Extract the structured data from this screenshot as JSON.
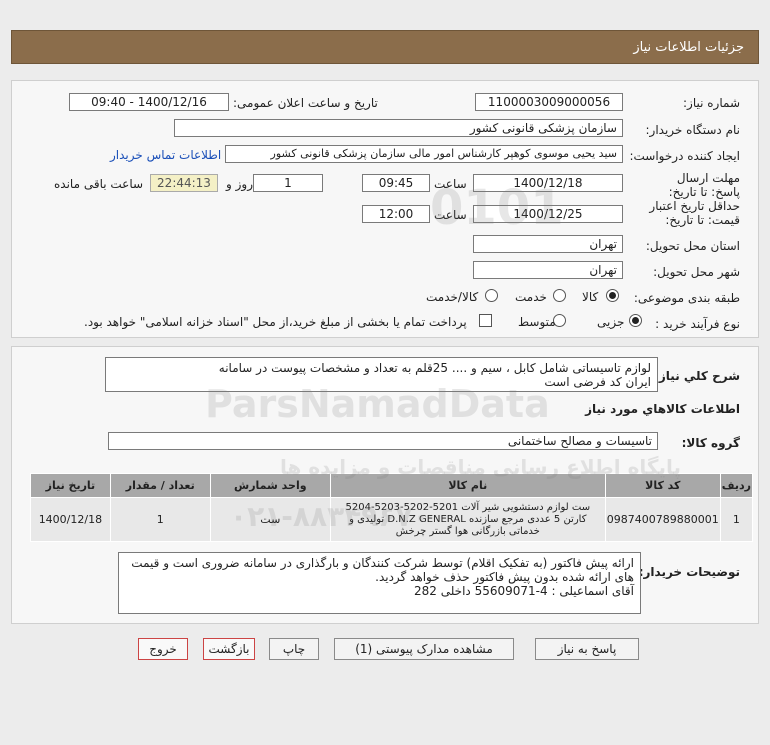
{
  "header": {
    "title": "جزئیات اطلاعات نیاز"
  },
  "info": {
    "need_number_label": "شماره نیاز:",
    "need_number": "1100003009000056",
    "announce_label": "تاریخ و ساعت اعلان عمومی:",
    "announce_value": "1400/12/16 - 09:40",
    "buyer_org_label": "نام دستگاه خریدار:",
    "buyer_org": "سازمان پزشکی قانونی کشور",
    "creator_label": "ایجاد کننده درخواست:",
    "creator": "سید یحیی موسوی کوهپر کارشناس امور مالی سازمان پزشکی قانونی کشور",
    "contact_link": "اطلاعات تماس خریدار",
    "reply_deadline_label": "مهلت ارسال پاسخ: تا تاریخ:",
    "reply_date": "1400/12/18",
    "time_label": "ساعت",
    "reply_time": "09:45",
    "days_and_label": "روز و",
    "days": "1",
    "remaining_time": "22:44:13",
    "remaining_label": "ساعت باقی مانده",
    "validity_label": "حداقل تاریخ اعتبار قیمت: تا تاریخ:",
    "validity_date": "1400/12/25",
    "validity_time_label": "ساعت",
    "validity_time": "12:00",
    "province_label": "استان محل تحویل:",
    "province": "تهران",
    "city_label": "شهر محل تحویل:",
    "city": "تهران",
    "category_label": "طبقه بندی موضوعی:",
    "category_options": [
      "کالا",
      "خدمت",
      "کالا/خدمت"
    ],
    "process_label": "نوع فرآیند خرید :",
    "process_options": [
      "جزیی",
      "متوسط"
    ],
    "payment_note": "پرداخت تمام یا بخشی از مبلغ خرید،از محل \"اسناد خزانه اسلامی\" خواهد بود."
  },
  "need": {
    "summary_label": "شرح کلي نياز:",
    "summary": "لوازم تاسیساتی شامل کابل ، سیم  و .... 25قلم به تعداد و مشخصات پیوست در سامانه\nایران کد فرضی است",
    "goods_info_title": "اطلاعات کالاهاي مورد نياز",
    "group_label": "گروه کالا:",
    "group": "تاسیسات و مصالح ساختمانی",
    "table": {
      "headers": [
        "ردیف",
        "کد کالا",
        "نام کالا",
        "واحد شمارش",
        "تعداد / مقدار",
        "تاریخ نیاز"
      ],
      "rows": [
        {
          "row": "1",
          "code": "0987400789880001",
          "name": "ست لوازم دستشویی شیر آلات 5201-5202-5203-5204\nکارتن 5 عددی مرجع سازنده D.N.Z GENERAL تولیدی و\nخدماتی بازرگانی هوا گستر چرخش",
          "unit": "ست",
          "qty": "1",
          "date": "1400/12/18"
        }
      ]
    },
    "buyer_notes_label": "توضیحات خریدار:",
    "buyer_notes": "ارائه پیش فاکتور (به تفکیک اقلام) توسط شرکت کنندگان و بارگذاری در سامانه ضروری است و قیمت\nهای ارائه شده بدون پیش فاکتور حذف خواهد گردید.\nآقای اسماعیلی :     4-55609071 داخلی 282"
  },
  "buttons": {
    "reply": "پاسخ به نیاز",
    "attachments": "مشاهده مدارک پیوستی (1)",
    "print": "چاپ",
    "back": "بازگشت",
    "exit": "خروج"
  },
  "watermark": {
    "logo_text": "ParsNamadData",
    "fa_line": "پایگاه اطلاع رسانی مناقصات و مزایده ها",
    "phone": "۰۲۱-۸۸۳۴۹۶۷۰",
    "number": "0101"
  }
}
